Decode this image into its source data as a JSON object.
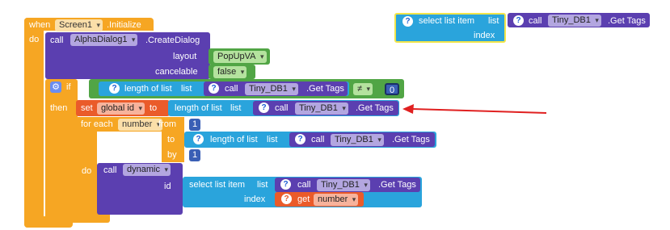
{
  "screen_init": {
    "when": "when",
    "component": "Screen1",
    "event": ".Initialize",
    "do": "do"
  },
  "create_dialog": {
    "call": "call",
    "component": "AlphaDialog1",
    "method": ".CreateDialog",
    "layout_label": "layout",
    "layout_value": "PopUpVA",
    "cancelable_label": "cancelable",
    "cancelable_value": "false"
  },
  "if_block": {
    "if": "if",
    "then": "then",
    "length_of_list": "length of list",
    "list": "list",
    "call": "call",
    "component": "Tiny_DB1",
    "method": ".Get Tags",
    "op": "≠",
    "compare_value": "0"
  },
  "set_block": {
    "set": "set",
    "variable": "global id",
    "to": "to",
    "length_of_list": "length of list",
    "list": "list",
    "call": "call",
    "component": "Tiny_DB1",
    "method": ".Get Tags"
  },
  "for_each": {
    "for_each": "for each",
    "variable": "number",
    "from": "from",
    "from_value": "1",
    "to": "to",
    "length_of_list": "length of list",
    "list": "list",
    "call": "call",
    "component": "Tiny_DB1",
    "method": ".Get Tags",
    "by": "by",
    "by_value": "1"
  },
  "do_block": {
    "do": "do",
    "call": "call",
    "component": "dynamic",
    "id": "id",
    "select_list_item": "select list item",
    "list": "list",
    "index": "index",
    "call2": "call",
    "component2": "Tiny_DB1",
    "method": ".Get Tags",
    "get": "get",
    "get_variable": "number"
  },
  "floating": {
    "select_list_item": "select list item",
    "list": "list",
    "index": "index",
    "call": "call",
    "component": "Tiny_DB1",
    "method": ".Get Tags"
  },
  "colors": {
    "event": "#f6a623",
    "component_call": "#5b3fb0",
    "list": "#2aa4dc",
    "logic": "#51a545",
    "variable": "#ea5b2a",
    "arrow": "#e02020"
  },
  "icons": {
    "help": "question-mark",
    "mutator": "gear",
    "arrow": "red-arrow"
  }
}
